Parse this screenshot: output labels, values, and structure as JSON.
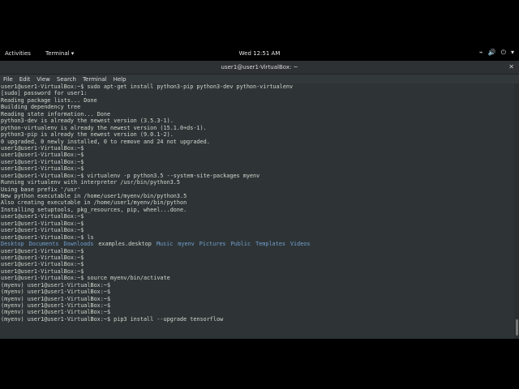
{
  "topbar": {
    "activities": "Activities",
    "app_menu": "Terminal ▾",
    "clock": "Wed 12:51 AM",
    "status_icons": [
      "⌁",
      "🔊",
      "⏻",
      "▾"
    ]
  },
  "window": {
    "title": "user1@user1-VirtualBox: ~",
    "close": "✕",
    "menu": [
      "File",
      "Edit",
      "View",
      "Search",
      "Terminal",
      "Help"
    ]
  },
  "terminal": {
    "lines": [
      "user1@user1-VirtualBox:~$ sudo apt-get install python3-pip python3-dev python-virtualenv",
      "[sudo] password for user1:",
      "Reading package lists... Done",
      "Building dependency tree",
      "Reading state information... Done",
      "python3-dev is already the newest version (3.5.3-1).",
      "python-virtualenv is already the newest version (15.1.0+ds-1).",
      "python3-pip is already the newest version (9.0.1-2).",
      "0 upgraded, 0 newly installed, 0 to remove and 24 not upgraded.",
      "user1@user1-VirtualBox:~$",
      "user1@user1-VirtualBox:~$",
      "user1@user1-VirtualBox:~$",
      "user1@user1-VirtualBox:~$",
      "user1@user1-VirtualBox:~$ virtualenv -p python3.5 --system-site-packages myenv",
      "Running virtualenv with interpreter /usr/bin/python3.5",
      "Using base prefix '/usr'",
      "New python executable in /home/user1/myenv/bin/python3.5",
      "Also creating executable in /home/user1/myenv/bin/python",
      "Installing setuptools, pkg_resources, pip, wheel...done.",
      "user1@user1-VirtualBox:~$",
      "user1@user1-VirtualBox:~$",
      "user1@user1-VirtualBox:~$",
      "user1@user1-VirtualBox:~$ ls"
    ],
    "ls_output": [
      {
        "name": "Desktop",
        "dir": true
      },
      {
        "name": "Documents",
        "dir": true
      },
      {
        "name": "Downloads",
        "dir": true
      },
      {
        "name": "examples.desktop",
        "dir": false
      },
      {
        "name": "Music",
        "dir": true
      },
      {
        "name": "myenv",
        "dir": true
      },
      {
        "name": "Pictures",
        "dir": true
      },
      {
        "name": "Public",
        "dir": true
      },
      {
        "name": "Templates",
        "dir": true
      },
      {
        "name": "Videos",
        "dir": true
      }
    ],
    "lines_after": [
      "user1@user1-VirtualBox:~$",
      "user1@user1-VirtualBox:~$",
      "user1@user1-VirtualBox:~$",
      "user1@user1-VirtualBox:~$",
      "user1@user1-VirtualBox:~$ source myenv/bin/activate",
      "(myenv) user1@user1-VirtualBox:~$",
      "(myenv) user1@user1-VirtualBox:~$",
      "(myenv) user1@user1-VirtualBox:~$",
      "(myenv) user1@user1-VirtualBox:~$",
      "(myenv) user1@user1-VirtualBox:~$",
      "(myenv) user1@user1-VirtualBox:~$ pip3 install --upgrade tensorflow"
    ]
  },
  "colors": {
    "terminal_bg": "#2e3436",
    "terminal_fg": "#d3d7cf",
    "directory": "#729fcf"
  }
}
